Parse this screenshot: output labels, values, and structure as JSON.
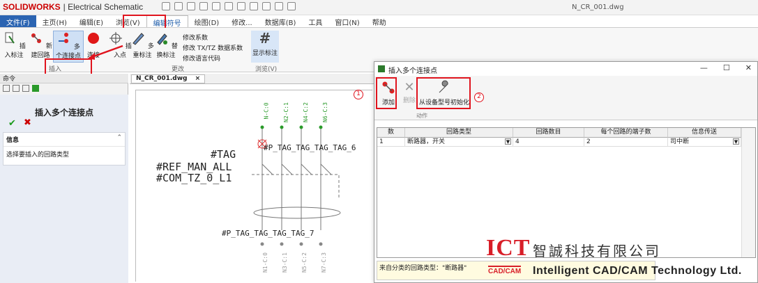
{
  "titlebar": {
    "brand": "SOLIDWORKS",
    "app_name": "| Electrical Schematic",
    "window_title": "N_CR_001.dwg"
  },
  "menu": {
    "tabs": [
      "文件(F)",
      "主页(H)",
      "编辑(E)",
      "浏览(V)",
      "编辑符号",
      "绘图(D)",
      "修改...",
      "数据库(B)",
      "工具",
      "窗口(N)",
      "帮助"
    ]
  },
  "ribbon": {
    "buttons": {
      "insert_label": "插入标注",
      "new_circuit": "新建回路",
      "multi_connect": "多个连接点",
      "connect": "连接",
      "insert_point": "插入点",
      "multi_mark": "多重标注",
      "replace_mark": "替换标注",
      "show_mark": "显示标注"
    },
    "small": {
      "modify_coeff": "修改系数",
      "modify_tx": "修改 TX/TZ 数据系数",
      "modify_lang": "修改语言代码"
    },
    "groups": {
      "insert": "插入",
      "change": "更改",
      "browse": "浏览(V)"
    }
  },
  "leftpanel": {
    "header": "命令",
    "title": "插入多个连接点",
    "ok": "✔",
    "cancel": "✖",
    "info_header": "信息",
    "info_text": "选择要插入的回路类型"
  },
  "doc": {
    "tab": "N_CR_001.dwg",
    "close": "×"
  },
  "canvas_text": {
    "tag": "#TAG",
    "ref": "#REF_MAN_ALL",
    "com": "#COM_TZ_0_L1",
    "ptag_top": "#P_TAG_TAG_TAG_TAG_6",
    "ptag_bottom": "#P_TAG_TAG_TAG_TAG_7",
    "top_pins": [
      "N-C:0",
      "N2-C:1",
      "N4-C:2",
      "N6-C:3"
    ],
    "bottom_pins": [
      "N1-C:0",
      "N3-C:1",
      "N5-C:2",
      "N7-C:3"
    ]
  },
  "dialog": {
    "title": "插入多个连接点",
    "buttons": {
      "add": "添加",
      "delete": "删除",
      "init": "从设备型号初始化"
    },
    "group_label": "动作",
    "badges": [
      "1",
      "2"
    ],
    "columns": [
      "数",
      "回路类型",
      "回路数目",
      "每个回路的端子数",
      "信息传送"
    ],
    "rows": [
      [
        "1",
        "断路器，开关",
        "4",
        "2",
        "司中断"
      ]
    ],
    "status": "来自分类的回路类型：\"断路器\""
  },
  "watermark": {
    "logo": "ICT",
    "logo_sub": "CAD/CAM",
    "company_cn": "智誠科技有限公司",
    "company_en": "Intelligent CAD/CAM Technology Ltd."
  },
  "colors": {
    "accent": "#2b64b2",
    "highlight_red": "#e0141e",
    "brand_red": "#d81e28"
  }
}
